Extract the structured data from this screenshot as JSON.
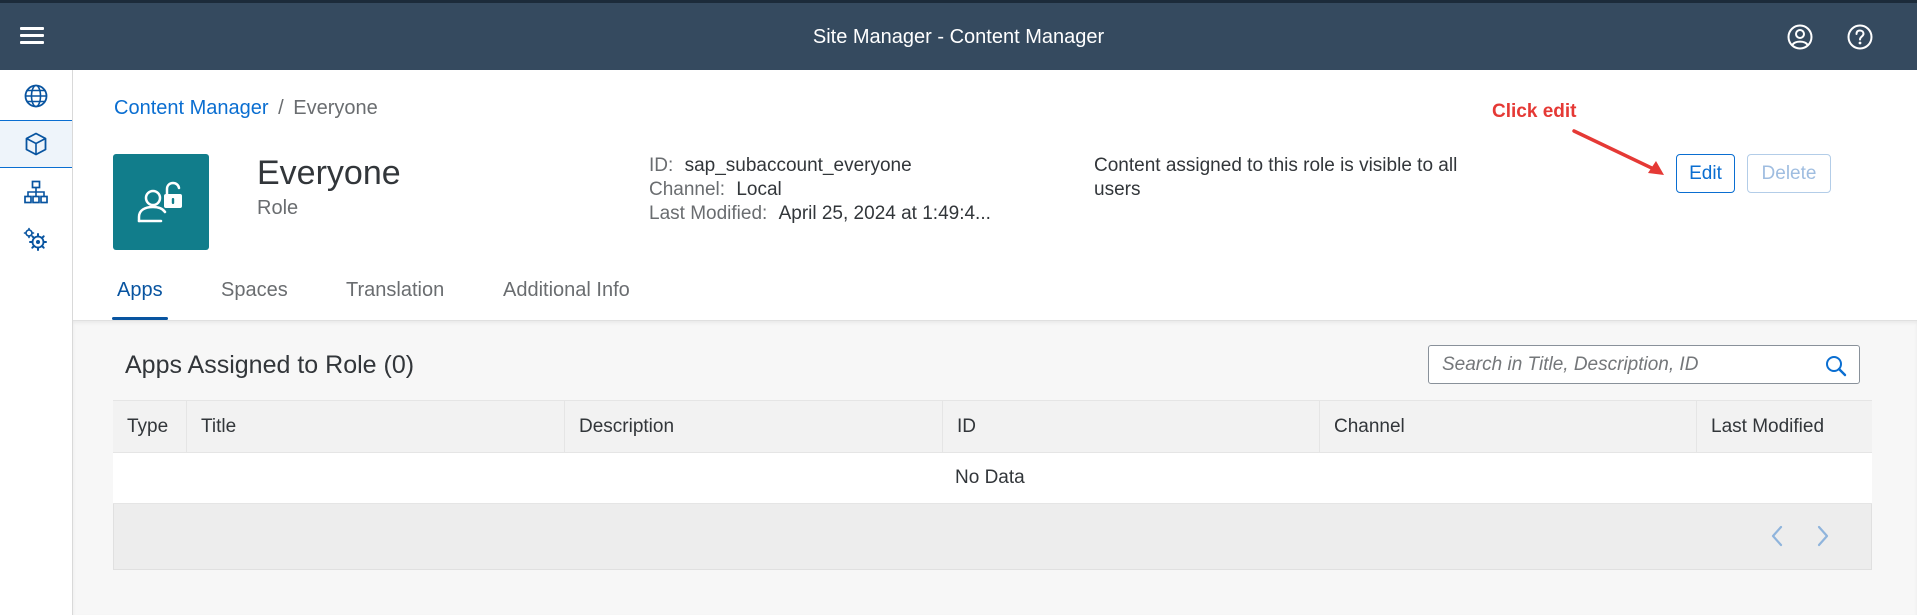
{
  "shell": {
    "title": "Site Manager - Content Manager",
    "menu_icon": "hamburger-menu-icon",
    "profile_icon": "user-profile-icon",
    "help_icon": "help-icon"
  },
  "sidenav": {
    "items": [
      {
        "icon": "globe-icon",
        "active": false
      },
      {
        "icon": "cube-icon",
        "active": true
      },
      {
        "icon": "org-hierarchy-icon",
        "active": false
      },
      {
        "icon": "gears-icon",
        "active": false
      }
    ]
  },
  "breadcrumb": {
    "link": "Content Manager",
    "separator": "/",
    "current": "Everyone"
  },
  "header": {
    "title": "Everyone",
    "subtitle": "Role",
    "avatar_icon": "user-unlocked-icon",
    "avatar_color": "#117d8b",
    "id_label": "ID:",
    "id_value": "sap_subaccount_everyone",
    "channel_label": "Channel:",
    "channel_value": "Local",
    "modified_label": "Last Modified:",
    "modified_value": "April 25, 2024 at 1:49:4...",
    "description": "Content assigned to this role is visible to all users",
    "edit_label": "Edit",
    "delete_label": "Delete"
  },
  "annotation": {
    "text": "Click edit",
    "color": "#e53935"
  },
  "tabs": [
    {
      "label": "Apps",
      "active": true
    },
    {
      "label": "Spaces",
      "active": false
    },
    {
      "label": "Translation",
      "active": false
    },
    {
      "label": "Additional Info",
      "active": false
    }
  ],
  "apps": {
    "section_title": "Apps Assigned to Role (0)",
    "search_placeholder": "Search in Title, Description, ID",
    "columns": [
      "Type",
      "Title",
      "Description",
      "ID",
      "Channel",
      "Last Modified"
    ],
    "no_data": "No Data"
  },
  "colors": {
    "shell_bg": "#354a5f",
    "accent": "#0a6ed1",
    "active_tab": "#0854a0"
  }
}
